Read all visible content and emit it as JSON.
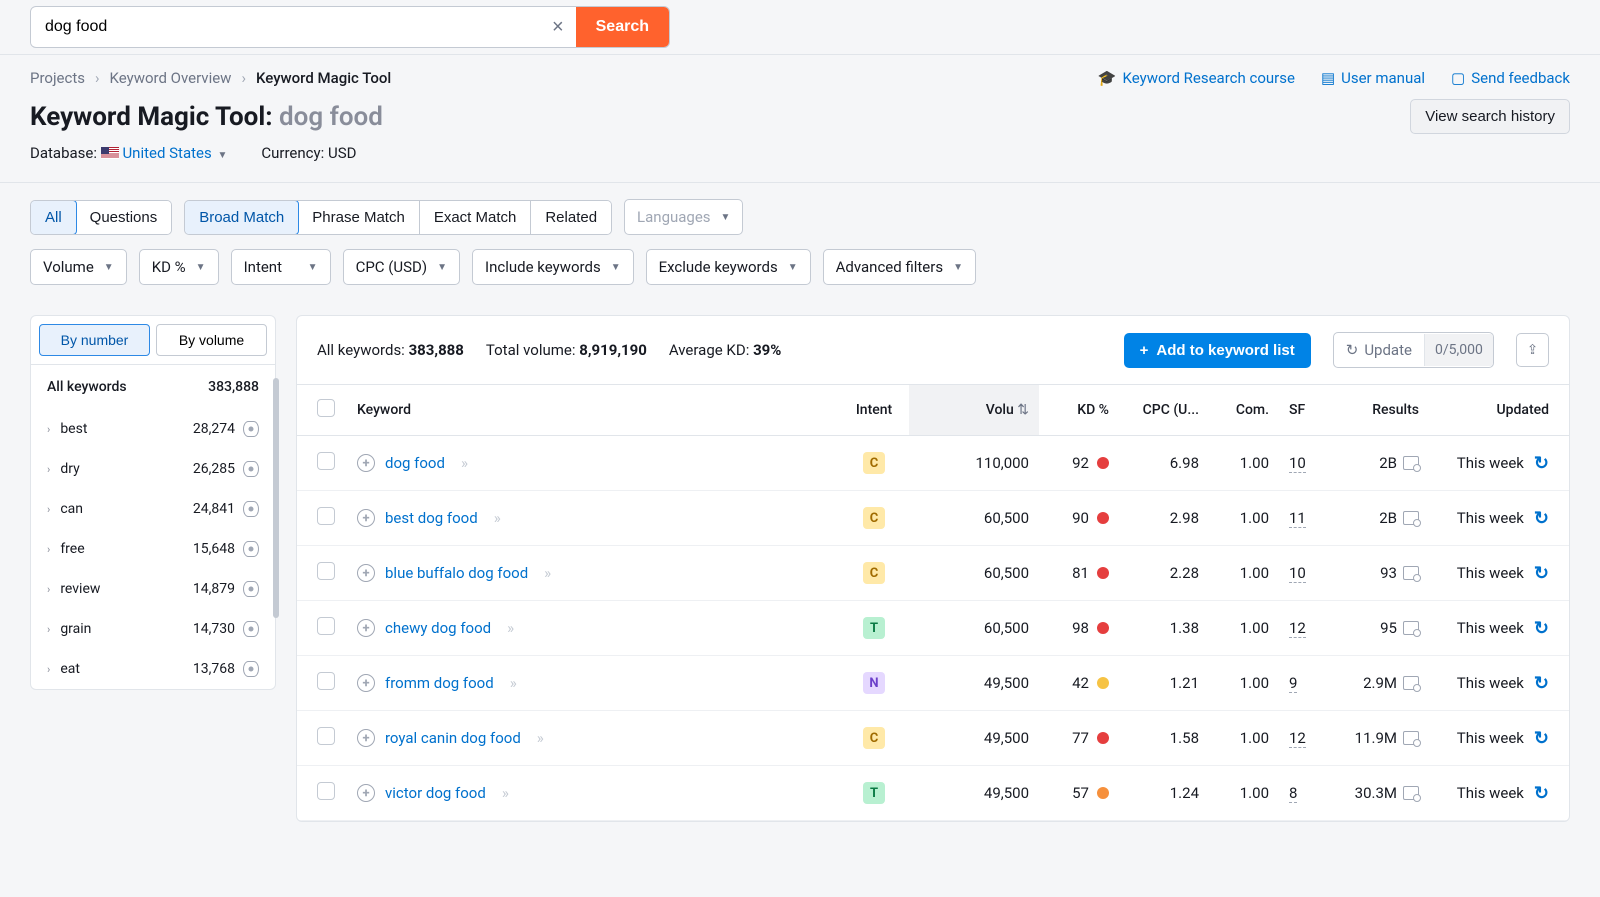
{
  "search": {
    "value": "dog food",
    "button": "Search"
  },
  "breadcrumbs": {
    "items": [
      "Projects",
      "Keyword Overview",
      "Keyword Magic Tool"
    ]
  },
  "helpLinks": {
    "course": "Keyword Research course",
    "manual": "User manual",
    "feedback": "Send feedback"
  },
  "title": {
    "tool": "Keyword Magic Tool:",
    "keyword": "dog food"
  },
  "viewHistory": "View search history",
  "meta": {
    "dbLabel": "Database:",
    "country": "United States",
    "currencyLabel": "Currency:",
    "currency": "USD"
  },
  "tabGroup1": {
    "all": "All",
    "questions": "Questions"
  },
  "tabGroup2": {
    "broad": "Broad Match",
    "phrase": "Phrase Match",
    "exact": "Exact Match",
    "related": "Related"
  },
  "langDd": "Languages",
  "filterDds": {
    "volume": "Volume",
    "kd": "KD %",
    "intent": "Intent",
    "cpc": "CPC (USD)",
    "include": "Include keywords",
    "exclude": "Exclude keywords",
    "advanced": "Advanced filters"
  },
  "sidebar": {
    "tabNumber": "By number",
    "tabVolume": "By volume",
    "headLabel": "All keywords",
    "headCount": "383,888",
    "items": [
      {
        "name": "best",
        "count": "28,274"
      },
      {
        "name": "dry",
        "count": "26,285"
      },
      {
        "name": "can",
        "count": "24,841"
      },
      {
        "name": "free",
        "count": "15,648"
      },
      {
        "name": "review",
        "count": "14,879"
      },
      {
        "name": "grain",
        "count": "14,730"
      },
      {
        "name": "eat",
        "count": "13,768"
      }
    ]
  },
  "summary": {
    "allKwLabel": "All keywords:",
    "allKwVal": "383,888",
    "totVolLabel": "Total volume:",
    "totVolVal": "8,919,190",
    "avgKdLabel": "Average KD:",
    "avgKdVal": "39%",
    "addBtn": "Add to keyword list",
    "updateLabel": "Update",
    "updateCount": "0/5,000"
  },
  "columns": {
    "keyword": "Keyword",
    "intent": "Intent",
    "volume": "Volu",
    "kd": "KD %",
    "cpc": "CPC (U...",
    "com": "Com.",
    "sf": "SF",
    "results": "Results",
    "updated": "Updated"
  },
  "rows": [
    {
      "keyword": "dog food",
      "intent": "C",
      "volume": "110,000",
      "kd": "92",
      "kdColor": "red",
      "cpc": "6.98",
      "com": "1.00",
      "sf": "10",
      "results": "2B",
      "updated": "This week"
    },
    {
      "keyword": "best dog food",
      "intent": "C",
      "volume": "60,500",
      "kd": "90",
      "kdColor": "red",
      "cpc": "2.98",
      "com": "1.00",
      "sf": "11",
      "results": "2B",
      "updated": "This week"
    },
    {
      "keyword": "blue buffalo dog food",
      "intent": "C",
      "volume": "60,500",
      "kd": "81",
      "kdColor": "red",
      "cpc": "2.28",
      "com": "1.00",
      "sf": "10",
      "results": "93",
      "updated": "This week"
    },
    {
      "keyword": "chewy dog food",
      "intent": "T",
      "volume": "60,500",
      "kd": "98",
      "kdColor": "red",
      "cpc": "1.38",
      "com": "1.00",
      "sf": "12",
      "results": "95",
      "updated": "This week"
    },
    {
      "keyword": "fromm dog food",
      "intent": "N",
      "volume": "49,500",
      "kd": "42",
      "kdColor": "yellow",
      "cpc": "1.21",
      "com": "1.00",
      "sf": "9",
      "results": "2.9M",
      "updated": "This week"
    },
    {
      "keyword": "royal canin dog food",
      "intent": "C",
      "volume": "49,500",
      "kd": "77",
      "kdColor": "red",
      "cpc": "1.58",
      "com": "1.00",
      "sf": "12",
      "results": "11.9M",
      "updated": "This week"
    },
    {
      "keyword": "victor dog food",
      "intent": "T",
      "volume": "49,500",
      "kd": "57",
      "kdColor": "orange",
      "cpc": "1.24",
      "com": "1.00",
      "sf": "8",
      "results": "30.3M",
      "updated": "This week"
    }
  ]
}
